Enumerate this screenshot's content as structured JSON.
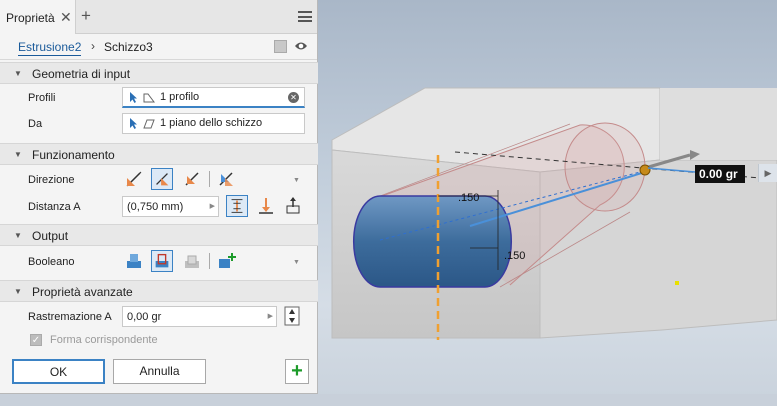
{
  "panel": {
    "tab_label": "Proprietà",
    "breadcrumb": [
      "Estrusione2",
      "Schizzo3"
    ],
    "sections": {
      "geometria": "Geometria di input",
      "funzionamento": "Funzionamento",
      "output": "Output",
      "avanzate": "Proprietà avanzate"
    },
    "profili": {
      "label": "Profili",
      "value": "1 profilo"
    },
    "da": {
      "label": "Da",
      "value": "1 piano dello schizzo"
    },
    "direzione_label": "Direzione",
    "distanza": {
      "label": "Distanza A",
      "value": "(0,750 mm)"
    },
    "booleano_label": "Booleano",
    "rastremazione": {
      "label": "Rastremazione A",
      "value": "0,00 gr"
    },
    "forma_corrispondente": "Forma corrispondente",
    "ok_label": "OK",
    "annulla_label": "Annulla"
  },
  "viewport": {
    "dim1": ".150",
    "dim2": ".150",
    "angle": "0.00 gr"
  },
  "colors": {
    "accent": "#3b82c4",
    "slot_blue": "#4a7ba8",
    "axis_orange": "#f0a030",
    "plus_green": "#1d9b2a"
  }
}
